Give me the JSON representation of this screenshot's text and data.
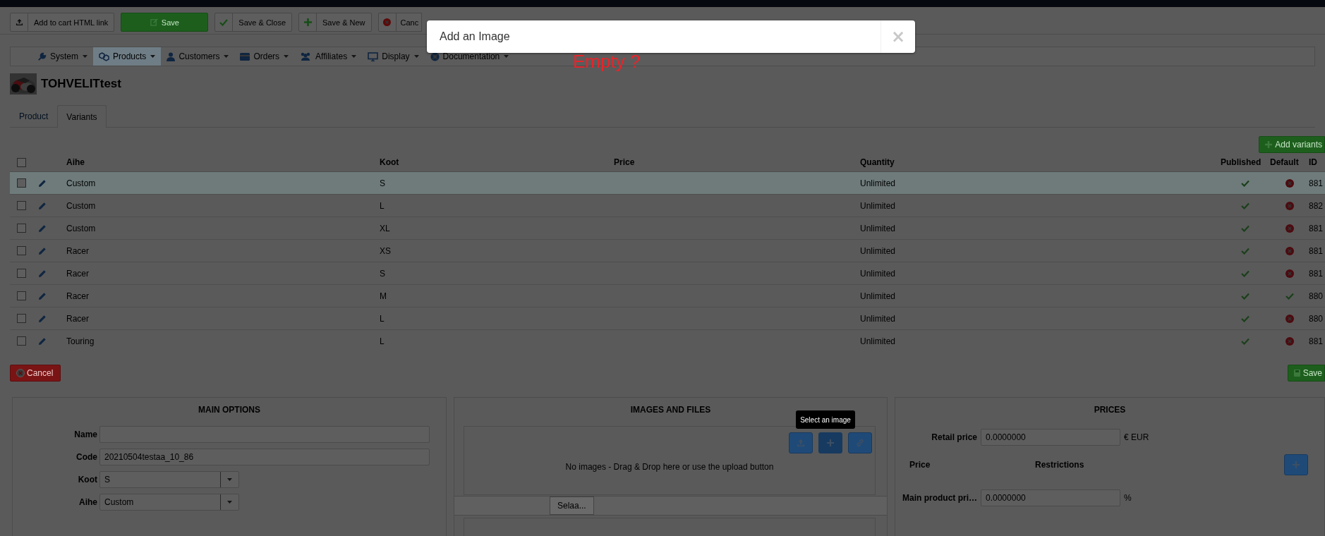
{
  "top_toolbar": {
    "buttons": [
      {
        "kind": "upload",
        "label": "Add to cart HTML link"
      },
      {
        "kind": "primary",
        "label": "Save"
      },
      {
        "kind": "check",
        "label": "Save & Close"
      },
      {
        "kind": "plus",
        "label": "Save & New"
      },
      {
        "kind": "cancel",
        "label": "Canc"
      }
    ]
  },
  "nav": [
    {
      "label": "System",
      "selected": false
    },
    {
      "label": "Products",
      "selected": true
    },
    {
      "label": "Customers",
      "selected": false
    },
    {
      "label": "Orders",
      "selected": false
    },
    {
      "label": "Affiliates",
      "selected": false
    },
    {
      "label": "Display",
      "selected": false
    },
    {
      "label": "Documentation",
      "selected": false
    }
  ],
  "product": {
    "title": "TOHVELITtest"
  },
  "tabs": [
    {
      "label": "Product",
      "selected": false
    },
    {
      "label": "Variants",
      "selected": true
    }
  ],
  "add_variants_button": "Add variants",
  "table": {
    "all_checked": false,
    "columns": [
      "Aihe",
      "Koot",
      "Price",
      "Quantity",
      "Published",
      "Default",
      "ID"
    ],
    "rows": [
      {
        "selected": true,
        "checked": false,
        "aihe": "Custom",
        "koot": "S",
        "quantity": "Unlimited",
        "published": true,
        "default": false,
        "id": "881"
      },
      {
        "selected": false,
        "checked": false,
        "aihe": "Custom",
        "koot": "L",
        "quantity": "Unlimited",
        "published": true,
        "default": false,
        "id": "882"
      },
      {
        "selected": false,
        "checked": false,
        "aihe": "Custom",
        "koot": "XL",
        "quantity": "Unlimited",
        "published": true,
        "default": false,
        "id": "881"
      },
      {
        "selected": false,
        "checked": false,
        "aihe": "Racer",
        "koot": "XS",
        "quantity": "Unlimited",
        "published": true,
        "default": false,
        "id": "881"
      },
      {
        "selected": false,
        "checked": false,
        "aihe": "Racer",
        "koot": "S",
        "quantity": "Unlimited",
        "published": true,
        "default": false,
        "id": "881"
      },
      {
        "selected": false,
        "checked": false,
        "aihe": "Racer",
        "koot": "M",
        "quantity": "Unlimited",
        "published": true,
        "default": true,
        "id": "880"
      },
      {
        "selected": false,
        "checked": false,
        "aihe": "Racer",
        "koot": "L",
        "quantity": "Unlimited",
        "published": true,
        "default": false,
        "id": "880"
      },
      {
        "selected": false,
        "checked": false,
        "aihe": "Touring",
        "koot": "L",
        "quantity": "Unlimited",
        "published": true,
        "default": false,
        "id": "881"
      }
    ]
  },
  "cancel_button": "Cancel",
  "save_button": "Save",
  "main_options": {
    "title": "MAIN OPTIONS",
    "fields": [
      {
        "kind": "text",
        "label": "Name"
      },
      {
        "kind": "text",
        "label": "Code",
        "value": "20210504testaa_10_86"
      },
      {
        "kind": "select",
        "label": "Koot",
        "value": "S"
      },
      {
        "kind": "select",
        "label": "Aihe",
        "value": "Custom"
      }
    ]
  },
  "images": {
    "title": "IMAGES AND FILES",
    "empty_text": "No images - Drag & Drop here or use the upload button",
    "browse_button": "Selaa...",
    "tooltip": "Select an image"
  },
  "prices": {
    "title": "PRICES",
    "retail_label": "Retail price",
    "retail_value": "0.0000000",
    "currency": "€ EUR",
    "columns": [
      "Price",
      "Restrictions"
    ],
    "main_label": "Main product pri…",
    "main_value": "0.0000000",
    "main_unit": "%"
  },
  "modal": {
    "title": "Add an Image",
    "close": "×"
  },
  "annotation": "Empty ?"
}
